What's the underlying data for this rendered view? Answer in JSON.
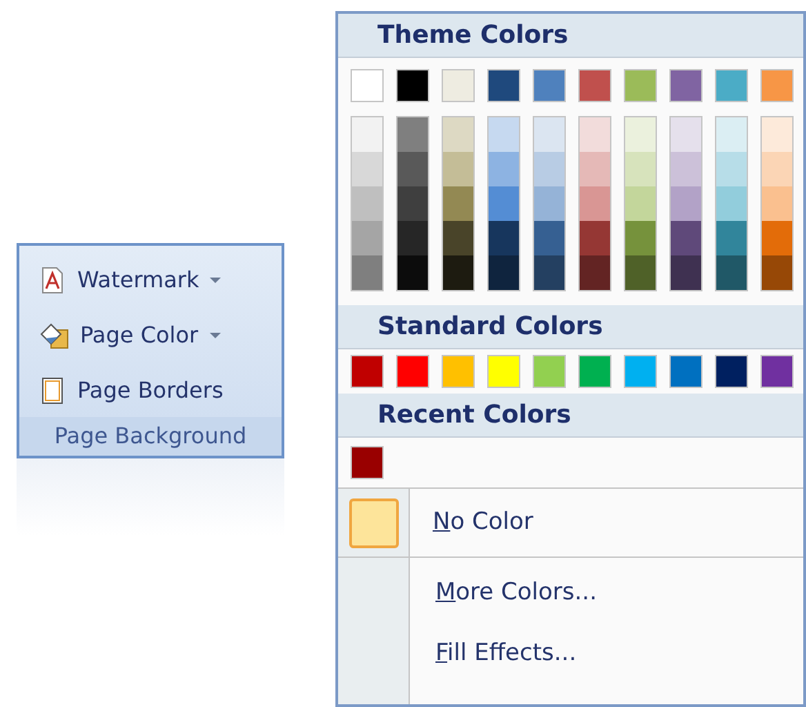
{
  "ribbon_group": {
    "items": [
      {
        "label": "Watermark",
        "kind": "watermark",
        "dropdown": true
      },
      {
        "label": "Page Color",
        "kind": "bucket",
        "dropdown": true
      },
      {
        "label": "Page Borders",
        "kind": "page",
        "dropdown": false
      }
    ],
    "title": "Page Background"
  },
  "color_menu": {
    "theme_header": "Theme Colors",
    "theme_colors": [
      {
        "color": "#ffffff"
      },
      {
        "color": "#000000"
      },
      {
        "color": "#eeece1"
      },
      {
        "color": "#1f497d"
      },
      {
        "color": "#4f81bd"
      },
      {
        "color": "#c0504d"
      },
      {
        "color": "#9bbb59"
      },
      {
        "color": "#8064a2"
      },
      {
        "color": "#4bacc6"
      },
      {
        "color": "#f79646"
      }
    ],
    "theme_shades": [
      {
        "shades": [
          {
            "color": "#f2f2f2"
          },
          {
            "color": "#d8d8d8"
          },
          {
            "color": "#bfbfbf"
          },
          {
            "color": "#a5a5a5"
          },
          {
            "color": "#7f7f7f"
          }
        ]
      },
      {
        "shades": [
          {
            "color": "#7f7f7f"
          },
          {
            "color": "#595959"
          },
          {
            "color": "#3f3f3f"
          },
          {
            "color": "#262626"
          },
          {
            "color": "#0c0c0c"
          }
        ]
      },
      {
        "shades": [
          {
            "color": "#ddd9c3"
          },
          {
            "color": "#c4bd97"
          },
          {
            "color": "#938953"
          },
          {
            "color": "#494429"
          },
          {
            "color": "#1d1b10"
          }
        ]
      },
      {
        "shades": [
          {
            "color": "#c6d9f0"
          },
          {
            "color": "#8db3e2"
          },
          {
            "color": "#548dd4"
          },
          {
            "color": "#17365d"
          },
          {
            "color": "#0f243e"
          }
        ]
      },
      {
        "shades": [
          {
            "color": "#dbe5f1"
          },
          {
            "color": "#b8cce4"
          },
          {
            "color": "#95b3d7"
          },
          {
            "color": "#366092"
          },
          {
            "color": "#244061"
          }
        ]
      },
      {
        "shades": [
          {
            "color": "#f2dcdb"
          },
          {
            "color": "#e5b9b7"
          },
          {
            "color": "#d99694"
          },
          {
            "color": "#953734"
          },
          {
            "color": "#632423"
          }
        ]
      },
      {
        "shades": [
          {
            "color": "#ebf1dd"
          },
          {
            "color": "#d7e3bc"
          },
          {
            "color": "#c3d69b"
          },
          {
            "color": "#76923c"
          },
          {
            "color": "#4f6128"
          }
        ]
      },
      {
        "shades": [
          {
            "color": "#e5e0ec"
          },
          {
            "color": "#ccc1d9"
          },
          {
            "color": "#b2a2c7"
          },
          {
            "color": "#5f497a"
          },
          {
            "color": "#3f3151"
          }
        ]
      },
      {
        "shades": [
          {
            "color": "#dbeef3"
          },
          {
            "color": "#b7dde8"
          },
          {
            "color": "#92cddc"
          },
          {
            "color": "#31859b"
          },
          {
            "color": "#205867"
          }
        ]
      },
      {
        "shades": [
          {
            "color": "#fdeada"
          },
          {
            "color": "#fbd5b5"
          },
          {
            "color": "#fac08f"
          },
          {
            "color": "#e36c09"
          },
          {
            "color": "#974806"
          }
        ]
      }
    ],
    "standard_header": "Standard Colors",
    "standard_colors": [
      {
        "color": "#c00000"
      },
      {
        "color": "#ff0000"
      },
      {
        "color": "#ffc000"
      },
      {
        "color": "#ffff00"
      },
      {
        "color": "#92d050"
      },
      {
        "color": "#00b050"
      },
      {
        "color": "#00b0f0"
      },
      {
        "color": "#0070c0"
      },
      {
        "color": "#002060"
      },
      {
        "color": "#7030a0"
      }
    ],
    "recent_header": "Recent Colors",
    "recent_colors": [
      {
        "color": "#990000"
      }
    ],
    "no_color": {
      "label": "No Color",
      "selected": true
    },
    "commands": [
      {
        "label": "More Colors..."
      },
      {
        "label": "Fill Effects..."
      }
    ]
  }
}
